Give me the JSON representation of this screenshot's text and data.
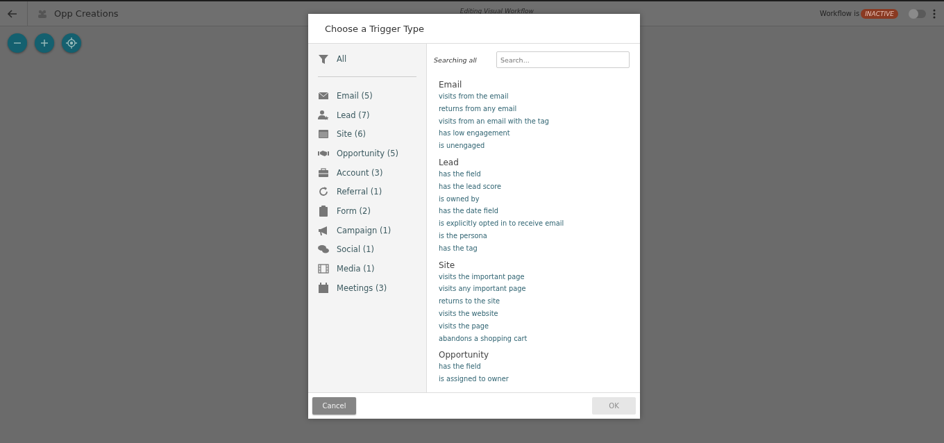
{
  "topbar": {
    "title": "Opp Creations",
    "subtitle": "Editing Visual Workflow",
    "status_label": "Workflow is",
    "status": "INACTIVE",
    "toggle": {
      "on": false
    }
  },
  "canvas_tools": [
    {
      "kind": "zoom-out"
    },
    {
      "kind": "zoom-in"
    },
    {
      "kind": "center"
    }
  ],
  "dialog": {
    "title": "Choose a Trigger Type",
    "filter_all": {
      "label": "All"
    },
    "categories": [
      {
        "label": "Email (5)",
        "kind": "envelope"
      },
      {
        "label": "Lead (7)",
        "kind": "person"
      },
      {
        "label": "Site (6)",
        "kind": "browser"
      },
      {
        "label": "Opportunity (5)",
        "kind": "handshake"
      },
      {
        "label": "Account (3)",
        "kind": "briefcase"
      },
      {
        "label": "Referral (1)",
        "kind": "refresh"
      },
      {
        "label": "Form (2)",
        "kind": "clipboard"
      },
      {
        "label": "Campaign (1)",
        "kind": "megaphone"
      },
      {
        "label": "Social (1)",
        "kind": "chat"
      },
      {
        "label": "Media (1)",
        "kind": "film"
      },
      {
        "label": "Meetings (3)",
        "kind": "calendar"
      }
    ],
    "searching_label": "Searching all",
    "search": {
      "placeholder": "Search..."
    },
    "groups": [
      {
        "title": "Email",
        "triggers": [
          "visits from the email",
          "returns from any email",
          "visits from an email with the tag",
          "has low engagement",
          "is unengaged"
        ]
      },
      {
        "title": "Lead",
        "triggers": [
          "has the field",
          "has the lead score",
          "is owned by",
          "has the date field",
          "is explicitly opted in to receive email",
          "is the persona",
          "has the tag"
        ]
      },
      {
        "title": "Site",
        "triggers": [
          "visits the important page",
          "visits any important page",
          "returns to the site",
          "visits the website",
          "visits the page",
          "abandons a shopping cart"
        ]
      },
      {
        "title": "Opportunity",
        "triggers": [
          "has the field",
          "is assigned to owner"
        ]
      }
    ],
    "cancel": {
      "label": "Cancel"
    },
    "ok": {
      "label": "OK",
      "disabled": true
    }
  }
}
